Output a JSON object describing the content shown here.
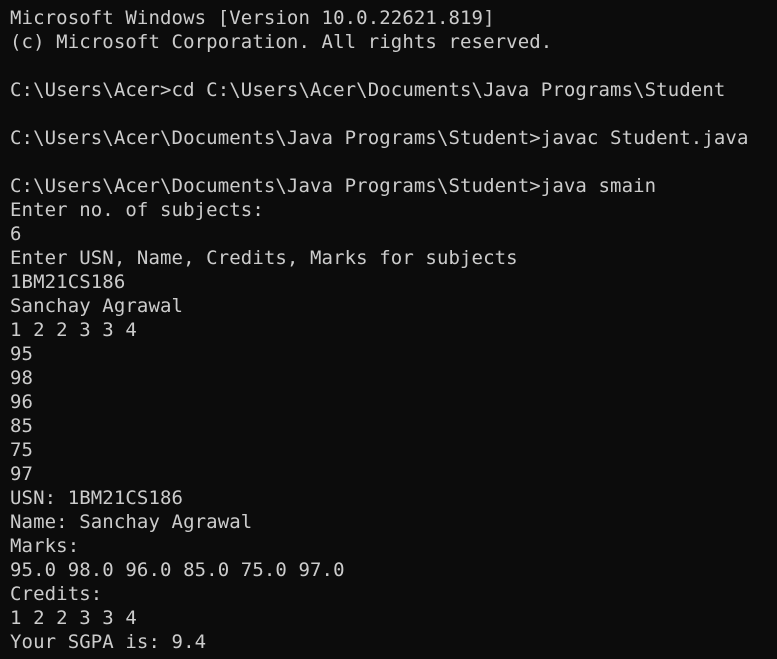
{
  "terminal": {
    "lines": [
      "Microsoft Windows [Version 10.0.22621.819]",
      "(c) Microsoft Corporation. All rights reserved.",
      "",
      "C:\\Users\\Acer>cd C:\\Users\\Acer\\Documents\\Java Programs\\Student",
      "",
      "C:\\Users\\Acer\\Documents\\Java Programs\\Student>javac Student.java",
      "",
      "C:\\Users\\Acer\\Documents\\Java Programs\\Student>java smain",
      "Enter no. of subjects:",
      "6",
      "Enter USN, Name, Credits, Marks for subjects",
      "1BM21CS186",
      "Sanchay Agrawal",
      "1 2 2 3 3 4",
      "95",
      "98",
      "96",
      "85",
      "75",
      "97",
      "USN: 1BM21CS186",
      "Name: Sanchay Agrawal",
      "Marks:",
      "95.0 98.0 96.0 85.0 75.0 97.0",
      "Credits:",
      "1 2 2 3 3 4",
      "Your SGPA is: 9.4"
    ]
  },
  "colors": {
    "background": "#0c0c0c",
    "text": "#cccccc"
  }
}
